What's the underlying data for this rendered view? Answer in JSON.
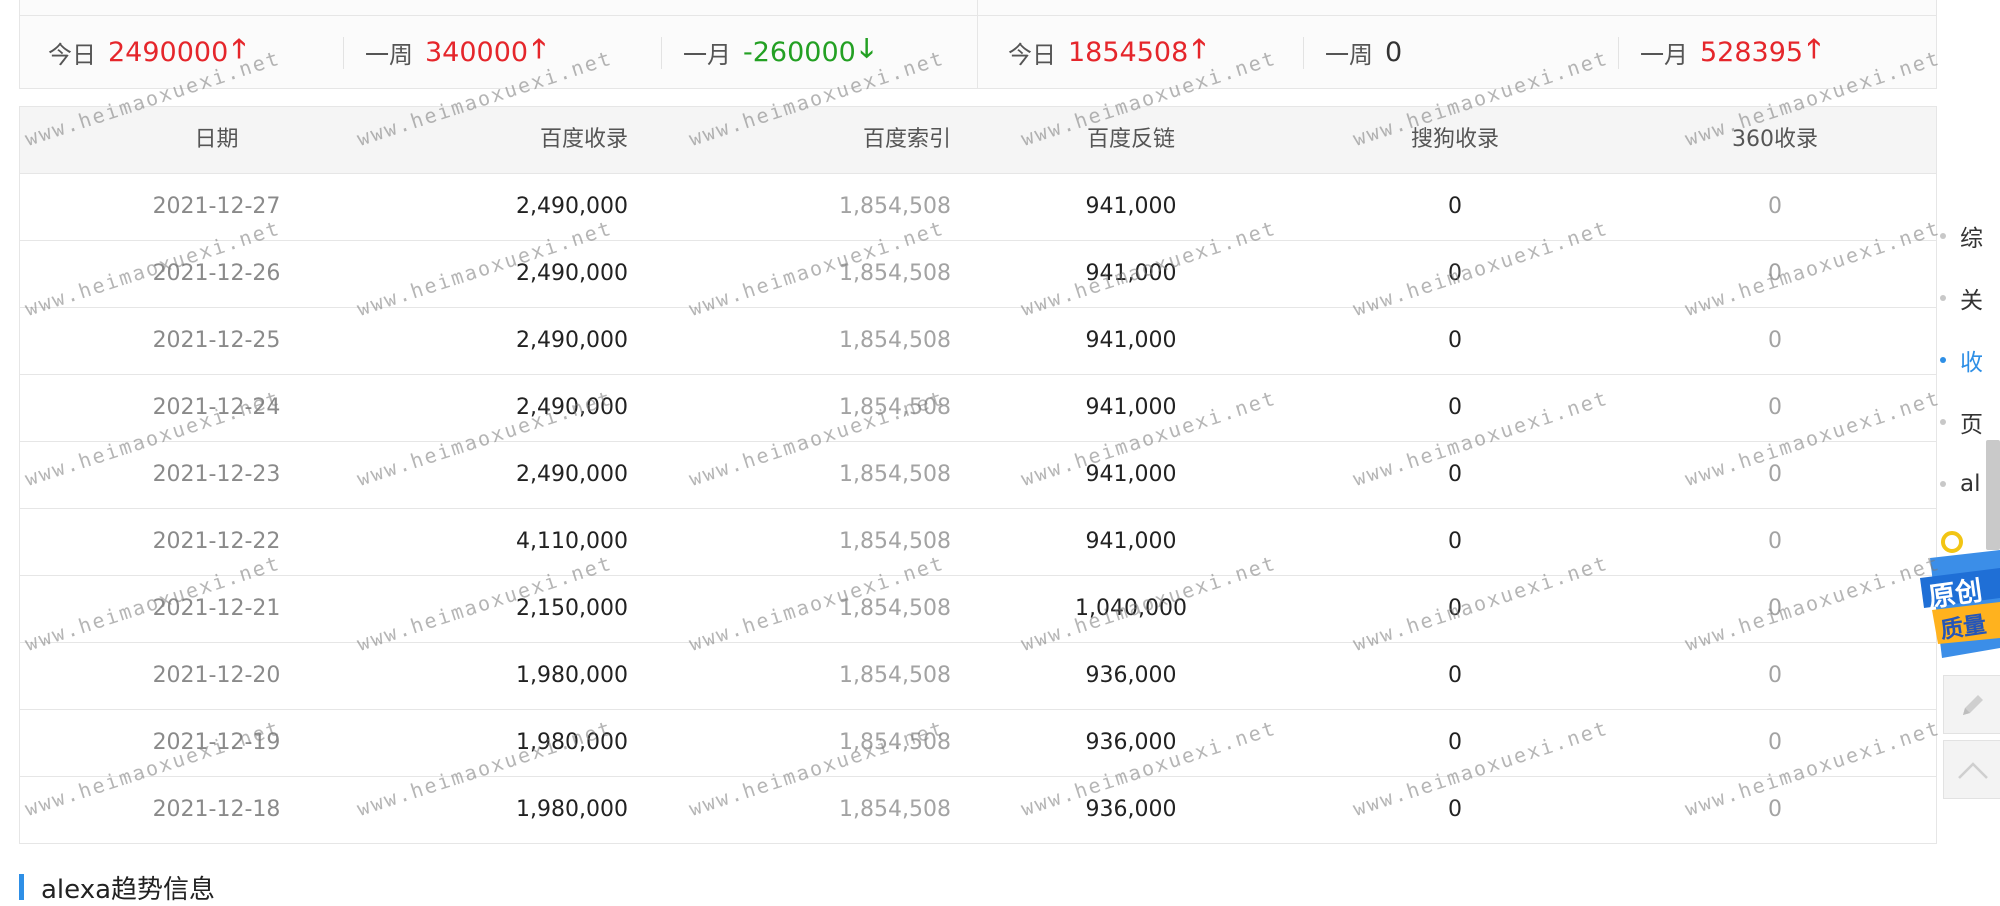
{
  "stats": {
    "left": [
      {
        "label": "今日",
        "value": "2490000",
        "trend": "up",
        "arrow": "🡑"
      },
      {
        "label": "一周",
        "value": "340000",
        "trend": "up",
        "arrow": "🡑"
      },
      {
        "label": "一月",
        "value": "-260000",
        "trend": "down",
        "arrow": "🡓"
      }
    ],
    "right": [
      {
        "label": "今日",
        "value": "1854508",
        "trend": "up",
        "arrow": "🡑"
      },
      {
        "label": "一周",
        "value": "0",
        "trend": "flat",
        "arrow": ""
      },
      {
        "label": "一月",
        "value": "528395",
        "trend": "up",
        "arrow": "🡑"
      }
    ]
  },
  "table": {
    "headers": {
      "date": "日期",
      "baidu_index": "百度收录",
      "baidu_search_index": "百度索引",
      "baidu_backlinks": "百度反链",
      "sogou_index": "搜狗收录",
      "so360_index": "360收录"
    },
    "rows": [
      {
        "date": "2021-12-27",
        "bd": "2,490,000",
        "idx": "1,854,508",
        "link": "941,000",
        "sg": "0",
        "s360": "0"
      },
      {
        "date": "2021-12-26",
        "bd": "2,490,000",
        "idx": "1,854,508",
        "link": "941,000",
        "sg": "0",
        "s360": "0"
      },
      {
        "date": "2021-12-25",
        "bd": "2,490,000",
        "idx": "1,854,508",
        "link": "941,000",
        "sg": "0",
        "s360": "0"
      },
      {
        "date": "2021-12-24",
        "bd": "2,490,000",
        "idx": "1,854,508",
        "link": "941,000",
        "sg": "0",
        "s360": "0"
      },
      {
        "date": "2021-12-23",
        "bd": "2,490,000",
        "idx": "1,854,508",
        "link": "941,000",
        "sg": "0",
        "s360": "0"
      },
      {
        "date": "2021-12-22",
        "bd": "4,110,000",
        "idx": "1,854,508",
        "link": "941,000",
        "sg": "0",
        "s360": "0"
      },
      {
        "date": "2021-12-21",
        "bd": "2,150,000",
        "idx": "1,854,508",
        "link": "1,040,000",
        "sg": "0",
        "s360": "0"
      },
      {
        "date": "2021-12-20",
        "bd": "1,980,000",
        "idx": "1,854,508",
        "link": "936,000",
        "sg": "0",
        "s360": "0"
      },
      {
        "date": "2021-12-19",
        "bd": "1,980,000",
        "idx": "1,854,508",
        "link": "936,000",
        "sg": "0",
        "s360": "0"
      },
      {
        "date": "2021-12-18",
        "bd": "1,980,000",
        "idx": "1,854,508",
        "link": "936,000",
        "sg": "0",
        "s360": "0"
      }
    ]
  },
  "section": {
    "title": "alexa趋势信息"
  },
  "side_nav": {
    "items": [
      {
        "label": "综",
        "active": false
      },
      {
        "label": "关",
        "active": false
      },
      {
        "label": "收",
        "active": true
      },
      {
        "label": "页",
        "active": false
      },
      {
        "label": "al",
        "active": false
      }
    ],
    "promo_line1": "原创",
    "promo_line2": "质量"
  },
  "watermark": "www.heimaoxuexi.net",
  "colors": {
    "up": "#e5262b",
    "down": "#23a023",
    "accent": "#2e8fe6"
  }
}
